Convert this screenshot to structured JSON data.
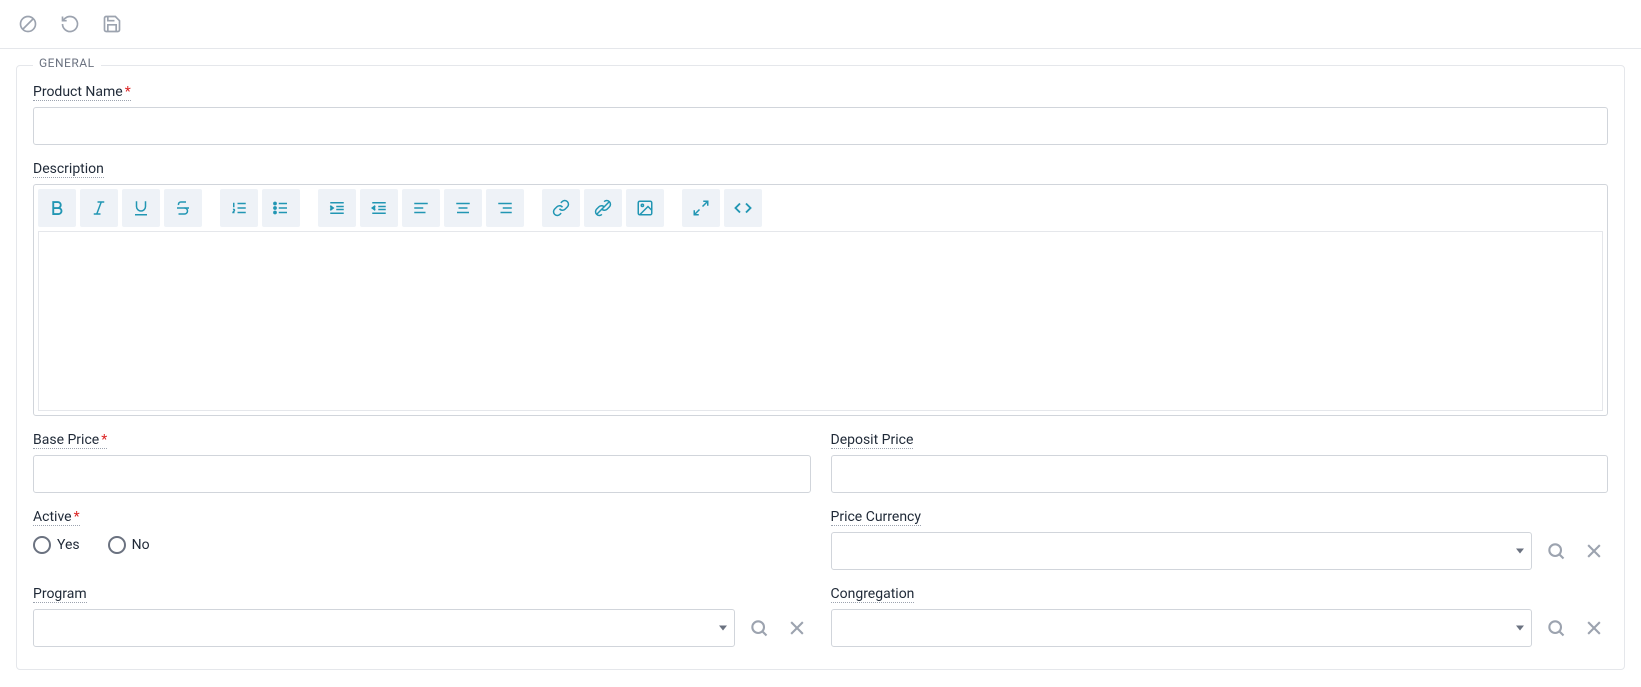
{
  "fieldset": {
    "legend": "GENERAL"
  },
  "fields": {
    "product_name": {
      "label": "Product Name",
      "value": ""
    },
    "description": {
      "label": "Description",
      "value": ""
    },
    "base_price": {
      "label": "Base Price",
      "value": ""
    },
    "deposit_price": {
      "label": "Deposit Price",
      "value": ""
    },
    "active": {
      "label": "Active",
      "options": {
        "yes": "Yes",
        "no": "No"
      }
    },
    "price_currency": {
      "label": "Price Currency",
      "value": ""
    },
    "program": {
      "label": "Program",
      "value": ""
    },
    "congregation": {
      "label": "Congregation",
      "value": ""
    }
  },
  "required_marker": "*"
}
